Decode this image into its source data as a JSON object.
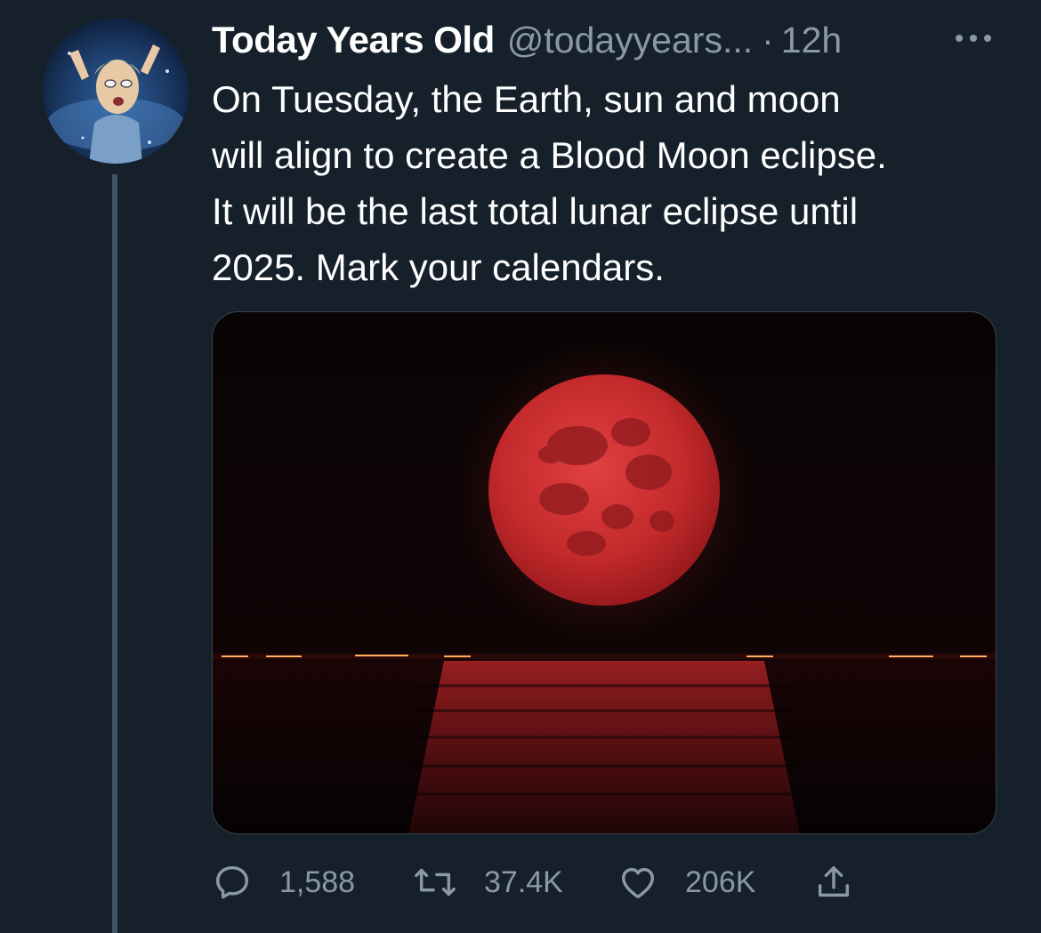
{
  "tweet": {
    "display_name": "Today Years Old",
    "handle": "@todayyears...",
    "separator": "·",
    "time": "12h",
    "text": "On Tuesday, the Earth, sun and moon\nwill align to create a Blood Moon eclipse.\nIt will be the last total lunar eclipse until\n2025. Mark your calendars."
  },
  "actions": {
    "replies": "1,588",
    "retweets": "37.4K",
    "likes": "206K"
  },
  "icons": {
    "more": "more-horizontal-icon",
    "reply": "reply-icon",
    "retweet": "retweet-icon",
    "like": "heart-icon",
    "share": "share-icon"
  },
  "colors": {
    "background": "#15202b",
    "secondary_text": "#8b98a5",
    "thread_line": "#3d5466"
  }
}
